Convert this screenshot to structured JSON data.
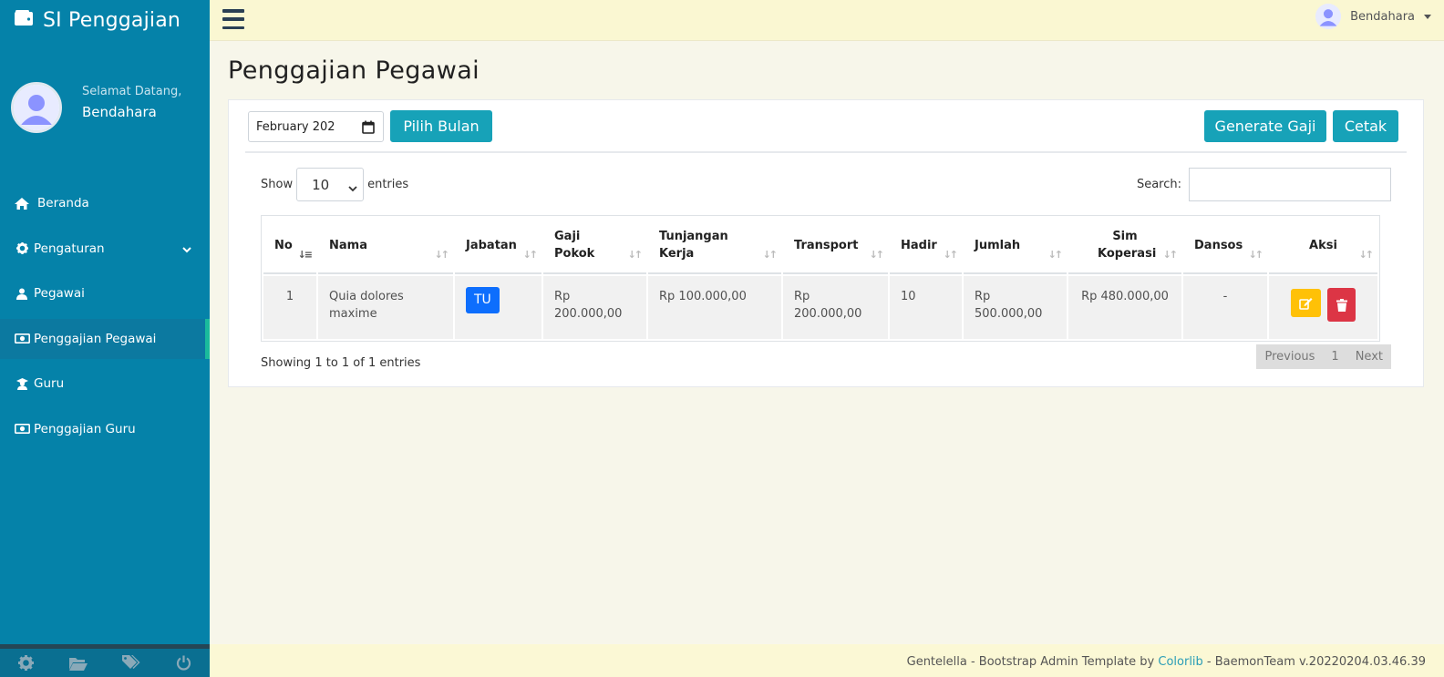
{
  "app": {
    "title": "SI Penggajian"
  },
  "profile": {
    "welcome": "Selamat Datang,",
    "name": "Bendahara"
  },
  "sidebar": {
    "items": [
      {
        "label": "Beranda",
        "icon": "home-icon"
      },
      {
        "label": "Pengaturan",
        "icon": "gear-icon"
      },
      {
        "label": "Pegawai",
        "icon": "user-icon"
      },
      {
        "label": "Penggajian Pegawai",
        "icon": "money-icon",
        "active": true
      },
      {
        "label": "Guru",
        "icon": "teacher-icon"
      },
      {
        "label": "Penggajian Guru",
        "icon": "money-icon"
      }
    ]
  },
  "topnav": {
    "user": "Bendahara"
  },
  "page": {
    "title": "Penggajian Pegawai"
  },
  "toolbar": {
    "month_value": "February 202",
    "pick_month_label": "Pilih Bulan",
    "generate_label": "Generate Gaji",
    "print_label": "Cetak"
  },
  "datatable": {
    "show_label": "Show",
    "length_value": "10",
    "entries_label": "entries",
    "search_label": "Search:",
    "columns": [
      "No",
      "Nama",
      "Jabatan",
      "Gaji Pokok",
      "Tunjangan Kerja",
      "Transport",
      "Hadir",
      "Jumlah",
      "Sim Koperasi",
      "Dansos",
      "Aksi"
    ],
    "rows": [
      {
        "no": "1",
        "nama": "Quia dolores maxime",
        "jabatan": "TU",
        "gaji_pokok": "Rp 200.000,00",
        "tunjangan": "Rp 100.000,00",
        "transport": "Rp 200.000,00",
        "hadir": "10",
        "jumlah": "Rp 500.000,00",
        "sim_koperasi": "Rp 480.000,00",
        "dansos": "-"
      }
    ],
    "info": "Showing 1 to 1 of 1 entries",
    "pagination": {
      "previous": "Previous",
      "page": "1",
      "next": "Next"
    }
  },
  "footer": {
    "text_before": "Gentelella - Bootstrap Admin Template by ",
    "link": "Colorlib",
    "text_after": " - BaemonTeam v.20220204.03.46.39"
  },
  "colors": {
    "sidebar": "#0582A9",
    "accent": "#17A2B8",
    "warning": "#FFC107",
    "danger": "#DC3545",
    "badge": "#0D6EFD"
  }
}
